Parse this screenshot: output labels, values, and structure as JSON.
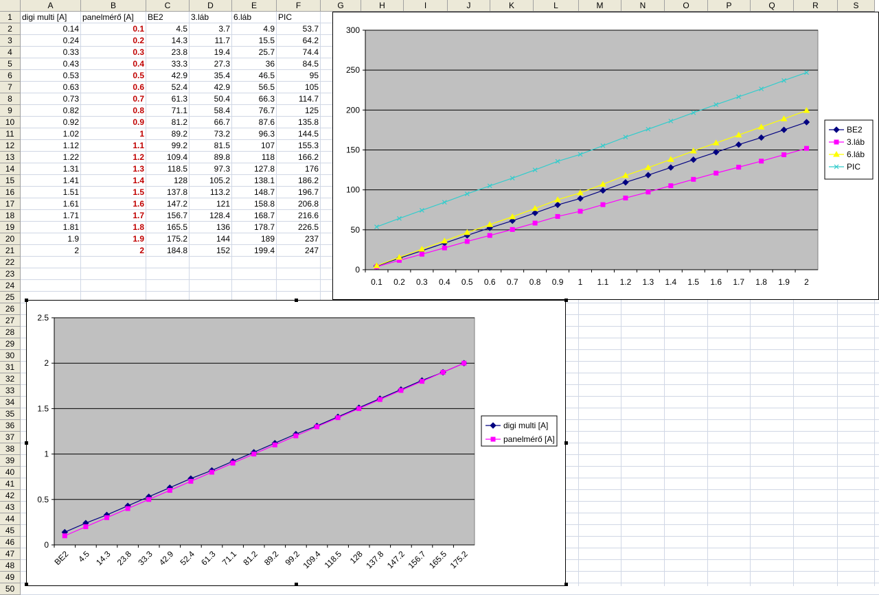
{
  "sheet": {
    "columns": [
      "A",
      "B",
      "C",
      "D",
      "E",
      "F",
      "G",
      "H",
      "I",
      "J",
      "K",
      "L",
      "M",
      "N",
      "O",
      "P",
      "Q",
      "R",
      "S"
    ],
    "rows": [
      "1",
      "2",
      "3",
      "4",
      "5",
      "6",
      "7",
      "8",
      "9",
      "10",
      "11",
      "12",
      "13",
      "14",
      "15",
      "16",
      "17",
      "18",
      "19",
      "20",
      "21",
      "22",
      "23",
      "24",
      "25",
      "26",
      "27",
      "28",
      "29",
      "30",
      "31",
      "32",
      "33",
      "34",
      "35",
      "36",
      "37",
      "38",
      "39",
      "40",
      "41",
      "42",
      "43",
      "44",
      "45",
      "46",
      "47",
      "48",
      "49",
      "50"
    ],
    "headers": [
      "digi multi [A]",
      "panelmérő [A]",
      "BE2",
      "3.láb",
      "6.láb",
      "PIC"
    ],
    "data": [
      [
        "0.14",
        "0.1",
        "4.5",
        "3.7",
        "4.9",
        "53.7"
      ],
      [
        "0.24",
        "0.2",
        "14.3",
        "11.7",
        "15.5",
        "64.2"
      ],
      [
        "0.33",
        "0.3",
        "23.8",
        "19.4",
        "25.7",
        "74.4"
      ],
      [
        "0.43",
        "0.4",
        "33.3",
        "27.3",
        "36",
        "84.5"
      ],
      [
        "0.53",
        "0.5",
        "42.9",
        "35.4",
        "46.5",
        "95"
      ],
      [
        "0.63",
        "0.6",
        "52.4",
        "42.9",
        "56.5",
        "105"
      ],
      [
        "0.73",
        "0.7",
        "61.3",
        "50.4",
        "66.3",
        "114.7"
      ],
      [
        "0.82",
        "0.8",
        "71.1",
        "58.4",
        "76.7",
        "125"
      ],
      [
        "0.92",
        "0.9",
        "81.2",
        "66.7",
        "87.6",
        "135.8"
      ],
      [
        "1.02",
        "1",
        "89.2",
        "73.2",
        "96.3",
        "144.5"
      ],
      [
        "1.12",
        "1.1",
        "99.2",
        "81.5",
        "107",
        "155.3"
      ],
      [
        "1.22",
        "1.2",
        "109.4",
        "89.8",
        "118",
        "166.2"
      ],
      [
        "1.31",
        "1.3",
        "118.5",
        "97.3",
        "127.8",
        "176"
      ],
      [
        "1.41",
        "1.4",
        "128",
        "105.2",
        "138.1",
        "186.2"
      ],
      [
        "1.51",
        "1.5",
        "137.8",
        "113.2",
        "148.7",
        "196.7"
      ],
      [
        "1.61",
        "1.6",
        "147.2",
        "121",
        "158.8",
        "206.8"
      ],
      [
        "1.71",
        "1.7",
        "156.7",
        "128.4",
        "168.7",
        "216.6"
      ],
      [
        "1.81",
        "1.8",
        "165.5",
        "136",
        "178.7",
        "226.5"
      ],
      [
        "1.9",
        "1.9",
        "175.2",
        "144",
        "189",
        "237"
      ],
      [
        "2",
        "2",
        "184.8",
        "152",
        "199.4",
        "247"
      ]
    ]
  },
  "colors": {
    "header_bg": "#ece9d8",
    "gridline": "#d0d7e5",
    "plot_bg": "#c0c0c0",
    "red_text": "#c00000"
  },
  "chart_data": [
    {
      "type": "line",
      "title": "",
      "xlabel": "",
      "ylabel": "",
      "ylim": [
        0,
        300
      ],
      "yticks": [
        "0",
        "50",
        "100",
        "150",
        "200",
        "250",
        "300"
      ],
      "categories": [
        "0.1",
        "0.2",
        "0.3",
        "0.4",
        "0.5",
        "0.6",
        "0.7",
        "0.8",
        "0.9",
        "1",
        "1.1",
        "1.2",
        "1.3",
        "1.4",
        "1.5",
        "1.6",
        "1.7",
        "1.8",
        "1.9",
        "2"
      ],
      "grid": true,
      "legend": "right",
      "series": [
        {
          "name": "BE2",
          "color": "#000080",
          "marker": "diamond",
          "values": [
            4.5,
            14.3,
            23.8,
            33.3,
            42.9,
            52.4,
            61.3,
            71.1,
            81.2,
            89.2,
            99.2,
            109.4,
            118.5,
            128,
            137.8,
            147.2,
            156.7,
            165.5,
            175.2,
            184.8
          ]
        },
        {
          "name": "3.láb",
          "color": "#ff00ff",
          "marker": "square",
          "values": [
            3.7,
            11.7,
            19.4,
            27.3,
            35.4,
            42.9,
            50.4,
            58.4,
            66.7,
            73.2,
            81.5,
            89.8,
            97.3,
            105.2,
            113.2,
            121,
            128.4,
            136,
            144,
            152
          ]
        },
        {
          "name": "6.láb",
          "color": "#ffff00",
          "marker": "triangle",
          "values": [
            4.9,
            15.5,
            25.7,
            36,
            46.5,
            56.5,
            66.3,
            76.7,
            87.6,
            96.3,
            107,
            118,
            127.8,
            138.1,
            148.7,
            158.8,
            168.7,
            178.7,
            189,
            199.4
          ]
        },
        {
          "name": "PIC",
          "color": "#33cccc",
          "marker": "x",
          "values": [
            53.7,
            64.2,
            74.4,
            84.5,
            95,
            105,
            114.7,
            125,
            135.8,
            144.5,
            155.3,
            166.2,
            176,
            186.2,
            196.7,
            206.8,
            216.6,
            226.5,
            237,
            247
          ]
        }
      ]
    },
    {
      "type": "line",
      "title": "",
      "xlabel": "",
      "ylabel": "",
      "ylim": [
        0,
        2.5
      ],
      "yticks": [
        "0",
        "0.5",
        "1",
        "1.5",
        "2",
        "2.5"
      ],
      "categories": [
        "BE2",
        "4.5",
        "14.3",
        "23.8",
        "33.3",
        "42.9",
        "52.4",
        "61.3",
        "71.1",
        "81.2",
        "89.2",
        "99.2",
        "109.4",
        "118.5",
        "128",
        "137.8",
        "147.2",
        "156.7",
        "165.5",
        "175.2"
      ],
      "grid": true,
      "legend": "right",
      "series": [
        {
          "name": "digi multi [A]",
          "color": "#000080",
          "marker": "diamond",
          "values": [
            0.14,
            0.24,
            0.33,
            0.43,
            0.53,
            0.63,
            0.73,
            0.82,
            0.92,
            1.02,
            1.12,
            1.22,
            1.31,
            1.41,
            1.51,
            1.61,
            1.71,
            1.81,
            1.9,
            2
          ]
        },
        {
          "name": "panelmérő [A]",
          "color": "#ff00ff",
          "marker": "square",
          "values": [
            0.1,
            0.2,
            0.3,
            0.4,
            0.5,
            0.6,
            0.7,
            0.8,
            0.9,
            1,
            1.1,
            1.2,
            1.3,
            1.4,
            1.5,
            1.6,
            1.7,
            1.8,
            1.9,
            2
          ]
        }
      ]
    }
  ]
}
